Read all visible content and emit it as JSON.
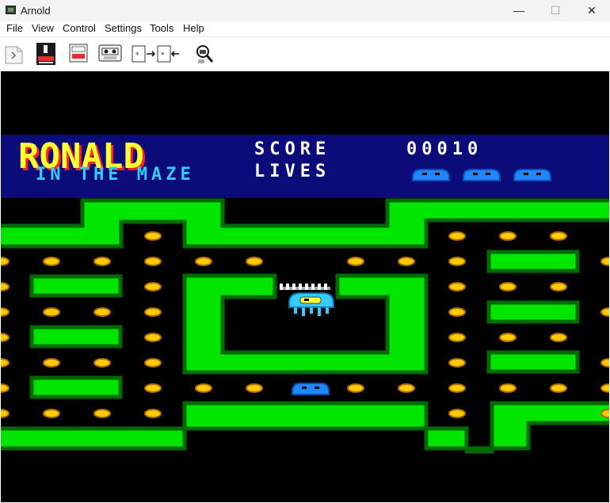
{
  "window": {
    "title": "Arnold",
    "minimize": "—",
    "maximize": "☐",
    "close": "✕"
  },
  "menu": [
    "File",
    "View",
    "Control",
    "Settings",
    "Tools",
    "Help"
  ],
  "toolbar": [
    "new-icon",
    "disk-drive-icon",
    "disk-eject-icon",
    "cassette-icon",
    "snapshot-transfer-icon",
    "debugger-icon"
  ],
  "game": {
    "logo_line1": "RONALD",
    "logo_line2": "IN THE MAZE",
    "score_label": "SCORE",
    "score_value": "00010",
    "lives_label": "LIVES",
    "lives": 3
  },
  "colors": {
    "hud_bg": "#0b0b7a",
    "wall": "#00e600",
    "wall_border": "#006b00",
    "dot": "#ffcc00",
    "ghost": "#1e88ff",
    "player": "#33ccff"
  }
}
